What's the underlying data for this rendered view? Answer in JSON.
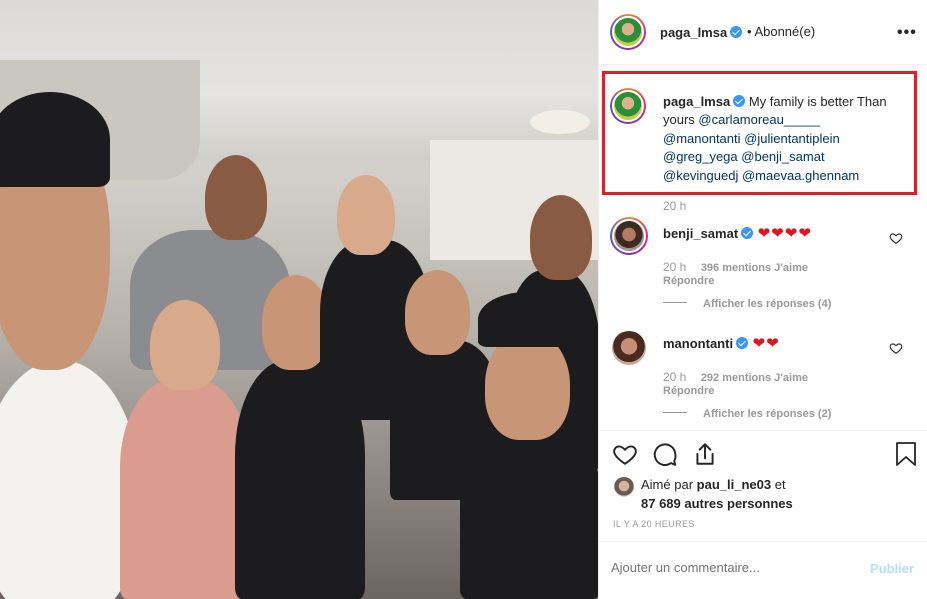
{
  "post": {
    "username": "paga_lmsa",
    "follow_status": "• Abonné(e)",
    "more_label": "•••",
    "caption": {
      "text": "My family is better Than yours",
      "mentions": [
        "@carlamoreau_____",
        "@manontanti",
        "@julientantiplein",
        "@greg_yega",
        "@benji_samat",
        "@kevinguedj",
        "@maevaa.ghennam"
      ],
      "time": "20 h"
    }
  },
  "comments": [
    {
      "username": "benji_samat",
      "text": "❤❤❤❤",
      "time": "20 h",
      "likes": "396 mentions J'aime",
      "reply": "Répondre",
      "view_replies": "Afficher les réponses (4)"
    },
    {
      "username": "manontanti",
      "text": "❤❤",
      "time": "20 h",
      "likes": "292 mentions J'aime",
      "reply": "Répondre",
      "view_replies": "Afficher les réponses (2)"
    }
  ],
  "liked_by": {
    "prefix": "Aimé par",
    "user": "pau_li_ne03",
    "connector": "et",
    "others": "87 689 autres personnes"
  },
  "timestamp": "IL Y A 20 HEURES",
  "comment_box": {
    "placeholder": "Ajouter un commentaire...",
    "publish_label": "Publier"
  },
  "colors": {
    "highlight_border": "#e11d2a",
    "verified": "#3897f0",
    "heart": "#e0141e",
    "mention": "#003569",
    "publish_disabled": "#b2dffc"
  }
}
